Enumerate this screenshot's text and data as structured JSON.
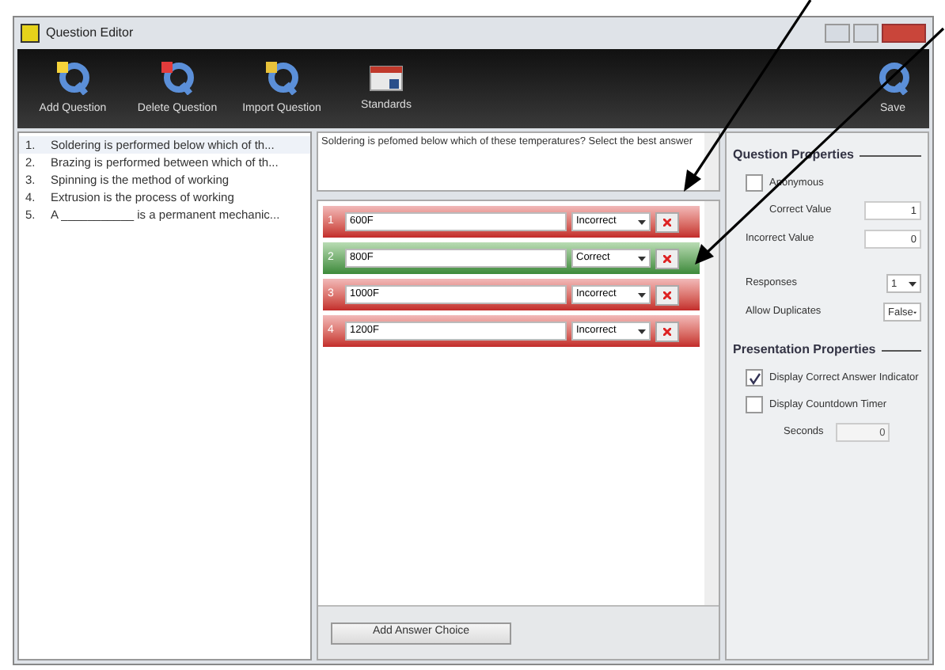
{
  "window": {
    "title": "Question Editor"
  },
  "toolbar": [
    {
      "label": "Add Question",
      "kind": "add"
    },
    {
      "label": "Delete Question",
      "kind": "delete"
    },
    {
      "label": "Import Question",
      "kind": "import"
    },
    {
      "label": "Standards",
      "kind": "standards"
    }
  ],
  "save": {
    "label": "Save"
  },
  "questions": [
    {
      "number": "1.",
      "text": "Soldering is performed below which of th...",
      "selected": true
    },
    {
      "number": "2.",
      "text": "Brazing is performed between which of th...",
      "selected": false
    },
    {
      "number": "3.",
      "text": "Spinning is the method of working",
      "selected": false
    },
    {
      "number": "4.",
      "text": "Extrusion is the process of working",
      "selected": false
    },
    {
      "number": "5.",
      "text": "A ___________ is a permanent mechanic...",
      "selected": false
    }
  ],
  "question_text": "Soldering is pefomed below which of these temperatures?  Select the best answer",
  "answers": [
    {
      "number": "1",
      "value": "600F",
      "result": "Incorrect",
      "correct": false
    },
    {
      "number": "2",
      "value": "800F",
      "result": "Correct",
      "correct": true
    },
    {
      "number": "3",
      "value": "1000F",
      "result": "Incorrect",
      "correct": false
    },
    {
      "number": "4",
      "value": "1200F",
      "result": "Incorrect",
      "correct": false
    }
  ],
  "add_answer": "Add Answer Choice",
  "question_properties": {
    "title": "Question Properties",
    "anonymous": {
      "label": "Anonymous",
      "checked": false
    },
    "correct_value": {
      "label": "Correct Value",
      "value": "1"
    },
    "incorrect_value": {
      "label": "Incorrect Value",
      "value": "0"
    },
    "responses": {
      "label": "Responses",
      "value": "1"
    },
    "allow_duplicates": {
      "label": "Allow Duplicates",
      "value": "False"
    }
  },
  "presentation_properties": {
    "title": "Presentation Properties",
    "correct_indicator": {
      "label": "Display Correct Answer Indicator",
      "checked": true
    },
    "countdown": {
      "label": "Display Countdown Timer",
      "checked": false
    },
    "seconds": {
      "label": "Seconds",
      "value": "0"
    }
  }
}
